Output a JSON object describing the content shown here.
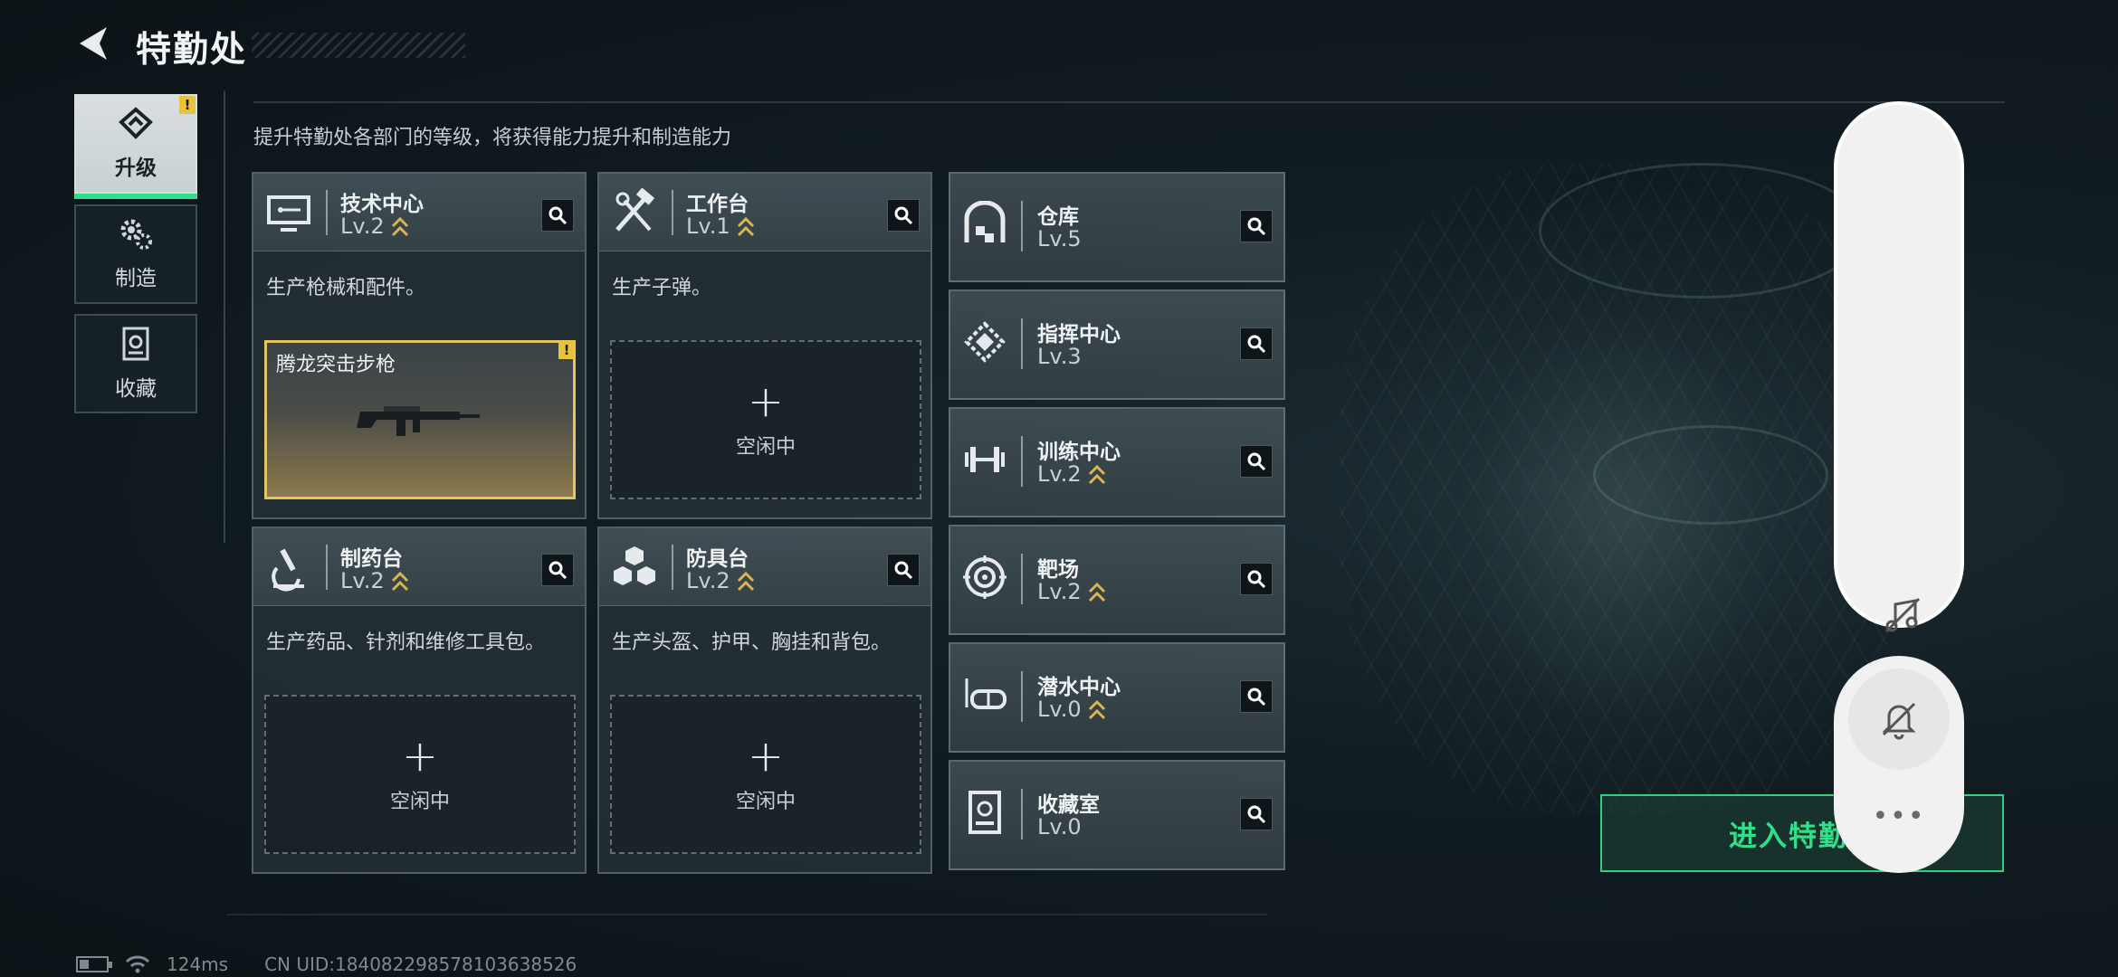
{
  "header": {
    "title": "特勤处"
  },
  "nav": [
    {
      "label": "升级",
      "icon": "upgrade-icon",
      "active": true,
      "warning": "!"
    },
    {
      "label": "制造",
      "icon": "gears-icon",
      "active": false
    },
    {
      "label": "收藏",
      "icon": "collection-icon",
      "active": false
    }
  ],
  "description": "提升特勤处各部门的等级，将获得能力提升和制造能力",
  "stations": [
    {
      "name": "技术中心",
      "level": "Lv.2",
      "upgradable": true,
      "desc": "生产枪械和配件。",
      "slot": {
        "state": "producing",
        "item": "腾龙突击步枪",
        "warning": "!"
      }
    },
    {
      "name": "工作台",
      "level": "Lv.1",
      "upgradable": true,
      "desc": "生产子弹。",
      "slot": {
        "state": "idle",
        "label": "空闲中",
        "plus": "+"
      }
    },
    {
      "name": "制药台",
      "level": "Lv.2",
      "upgradable": true,
      "desc": "生产药品、针剂和维修工具包。",
      "slot": {
        "state": "idle",
        "label": "空闲中",
        "plus": "+"
      }
    },
    {
      "name": "防具台",
      "level": "Lv.2",
      "upgradable": true,
      "desc": "生产头盔、护甲、胸挂和背包。",
      "slot": {
        "state": "idle",
        "label": "空闲中",
        "plus": "+"
      }
    }
  ],
  "facilities": [
    {
      "name": "仓库",
      "level": "Lv.5",
      "upgradable": false
    },
    {
      "name": "指挥中心",
      "level": "Lv.3",
      "upgradable": false
    },
    {
      "name": "训练中心",
      "level": "Lv.2",
      "upgradable": true
    },
    {
      "name": "靶场",
      "level": "Lv.2",
      "upgradable": true
    },
    {
      "name": "潜水中心",
      "level": "Lv.0",
      "upgradable": true
    },
    {
      "name": "收藏室",
      "level": "Lv.0",
      "upgradable": false
    }
  ],
  "enter_button": {
    "label": "进入特勤"
  },
  "overlay": {
    "more": "•••"
  },
  "status": {
    "ping": "124ms",
    "uid": "CN UID:18408229857810363852​6"
  },
  "colors": {
    "accent_green": "#2fe08a",
    "warning_yellow": "#e8c23a",
    "upgrade_gold": "#d8b451"
  }
}
